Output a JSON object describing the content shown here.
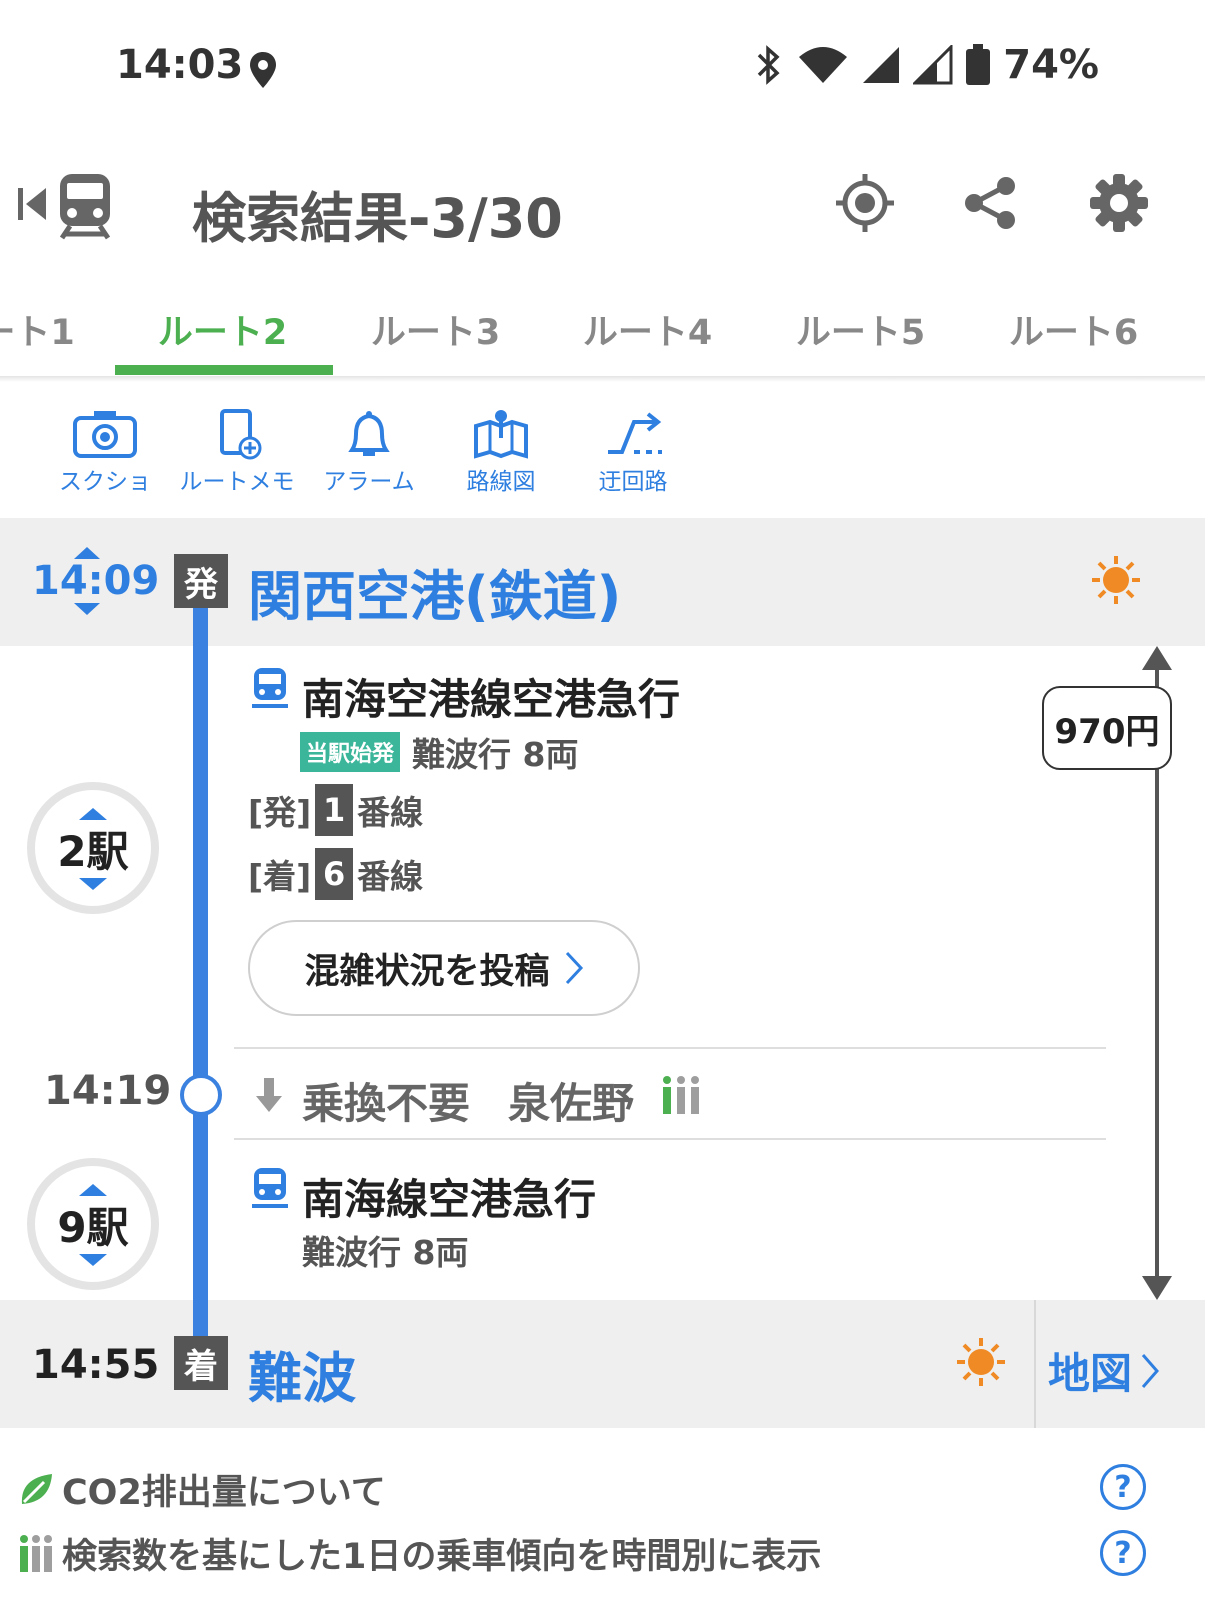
{
  "status_bar": {
    "time": "14:03",
    "battery": "74%",
    "icons": [
      "location-icon",
      "bluetooth-icon",
      "wifi-icon",
      "signal-icon",
      "signal-icon",
      "battery-icon"
    ]
  },
  "header": {
    "title": "検索結果-3/30"
  },
  "tabs": [
    "ート1",
    "ルート2",
    "ルート3",
    "ルート4",
    "ルート5",
    "ルート6"
  ],
  "toolbar": {
    "screenshot": "スクショ",
    "route_memo": "ルートメモ",
    "alarm": "アラーム",
    "route_map": "路線図",
    "detour": "迂回路"
  },
  "departure": {
    "time": "14:09",
    "badge": "発",
    "station": "関西空港(鉄道)"
  },
  "leg1": {
    "train": "南海空港線空港急行",
    "origin_badge": "当駅始発",
    "destination": "難波行 8両",
    "dep_prefix": "[発]",
    "dep_track": "1",
    "arr_prefix": "[着]",
    "arr_track": "6",
    "track_suffix": "番線",
    "stops": "2駅",
    "post_button": "混雑状況を投稿"
  },
  "transfer": {
    "time": "14:19",
    "label": "乗換不要",
    "station": "泉佐野"
  },
  "leg2": {
    "train": "南海線空港急行",
    "destination": "難波行 8両",
    "stops": "9駅"
  },
  "fare": "970円",
  "arrival": {
    "time": "14:55",
    "badge": "着",
    "station": "難波",
    "map_link": "地図"
  },
  "footer": {
    "co2": "CO2排出量について",
    "trend": "検索数を基にした1日の乗車傾向を時間別に表示",
    "help": "?"
  },
  "colors": {
    "accent_blue": "#2f7fe0",
    "tab_green": "#4caf50",
    "weather_orange": "#f08a24",
    "line_blue": "#3b82e0"
  }
}
